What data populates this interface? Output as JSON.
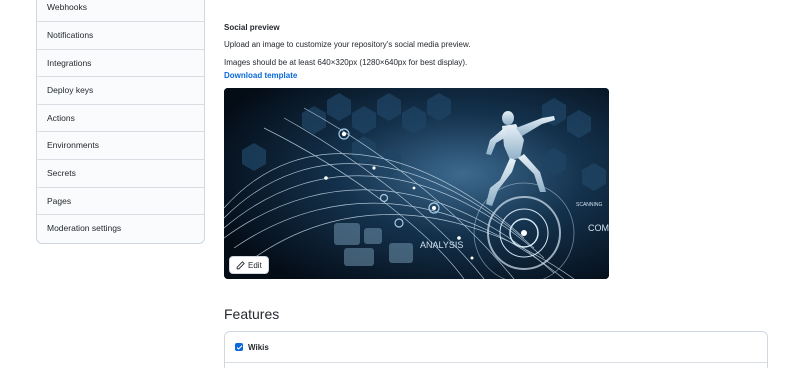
{
  "sidebar": {
    "items": [
      {
        "label": "Webhooks"
      },
      {
        "label": "Notifications"
      },
      {
        "label": "Integrations"
      },
      {
        "label": "Deploy keys"
      },
      {
        "label": "Actions"
      },
      {
        "label": "Environments"
      },
      {
        "label": "Secrets"
      },
      {
        "label": "Pages"
      },
      {
        "label": "Moderation settings"
      }
    ]
  },
  "social_preview": {
    "title": "Social preview",
    "description": "Upload an image to customize your repository's social media preview.",
    "requirements": "Images should be at least 640×320px (1280×640px for best display).",
    "download_link": "Download template",
    "image_text_1": "ANALYSIS",
    "image_text_2": "SCANNING",
    "image_text_3": "COM",
    "edit_label": "Edit"
  },
  "features": {
    "title": "Features",
    "items": [
      {
        "label": "Wikis",
        "checked": true
      }
    ]
  },
  "colors": {
    "link": "#0969da",
    "checkbox": "#0969da",
    "border": "#d0d7de"
  }
}
